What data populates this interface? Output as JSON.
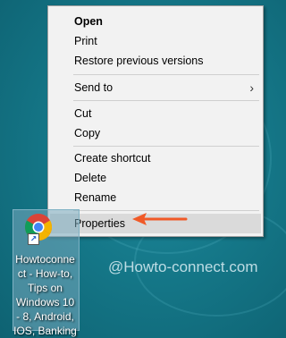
{
  "context_menu": {
    "items": [
      {
        "label": "Open",
        "bold": true
      },
      {
        "label": "Print"
      },
      {
        "label": "Restore previous versions"
      },
      {
        "label": "Send to",
        "submenu": true
      },
      {
        "label": "Cut"
      },
      {
        "label": "Copy"
      },
      {
        "label": "Create shortcut"
      },
      {
        "label": "Delete"
      },
      {
        "label": "Rename"
      },
      {
        "label": "Properties",
        "highlighted": true
      }
    ],
    "submenu_arrow_glyph": "›"
  },
  "desktop_icon": {
    "lines": [
      "Howtoconne",
      "ct - How-to,",
      "Tips on",
      "Windows 10",
      "- 8, Android,",
      "IOS, Banking"
    ],
    "icon": "chrome-icon",
    "shortcut_badge": "↗"
  },
  "watermark": "@Howto-connect.com",
  "colors": {
    "desktop": "#157889",
    "menu_bg": "#f2f2f2",
    "highlight": "#dadada",
    "arrow": "#f05a28"
  }
}
